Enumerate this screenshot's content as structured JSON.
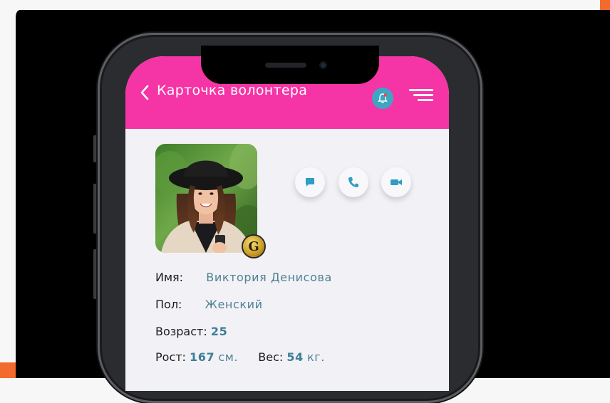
{
  "header": {
    "title": "Карточка волонтера",
    "color": "#f534a5"
  },
  "icons": {
    "back": "chevron-left-icon",
    "notifications": "bell-icon",
    "menu": "menu-icon",
    "message": "message-icon",
    "call": "phone-icon",
    "video": "video-icon"
  },
  "badge": {
    "letter": "G"
  },
  "profile": {
    "name_label": "Имя:",
    "name_value": "Виктория Денисова",
    "gender_label": "Пол:",
    "gender_value": "Женский",
    "age_label": "Возраст:",
    "age_value": "25",
    "height_label": "Рост:",
    "height_value": "167",
    "height_unit": "см.",
    "weight_label": "Вес:",
    "weight_value": "54",
    "weight_unit": "кг."
  },
  "colors": {
    "accent_blue": "#3fa5c2",
    "value_text": "#4e7f93",
    "background_orange": "#f26b2c"
  }
}
